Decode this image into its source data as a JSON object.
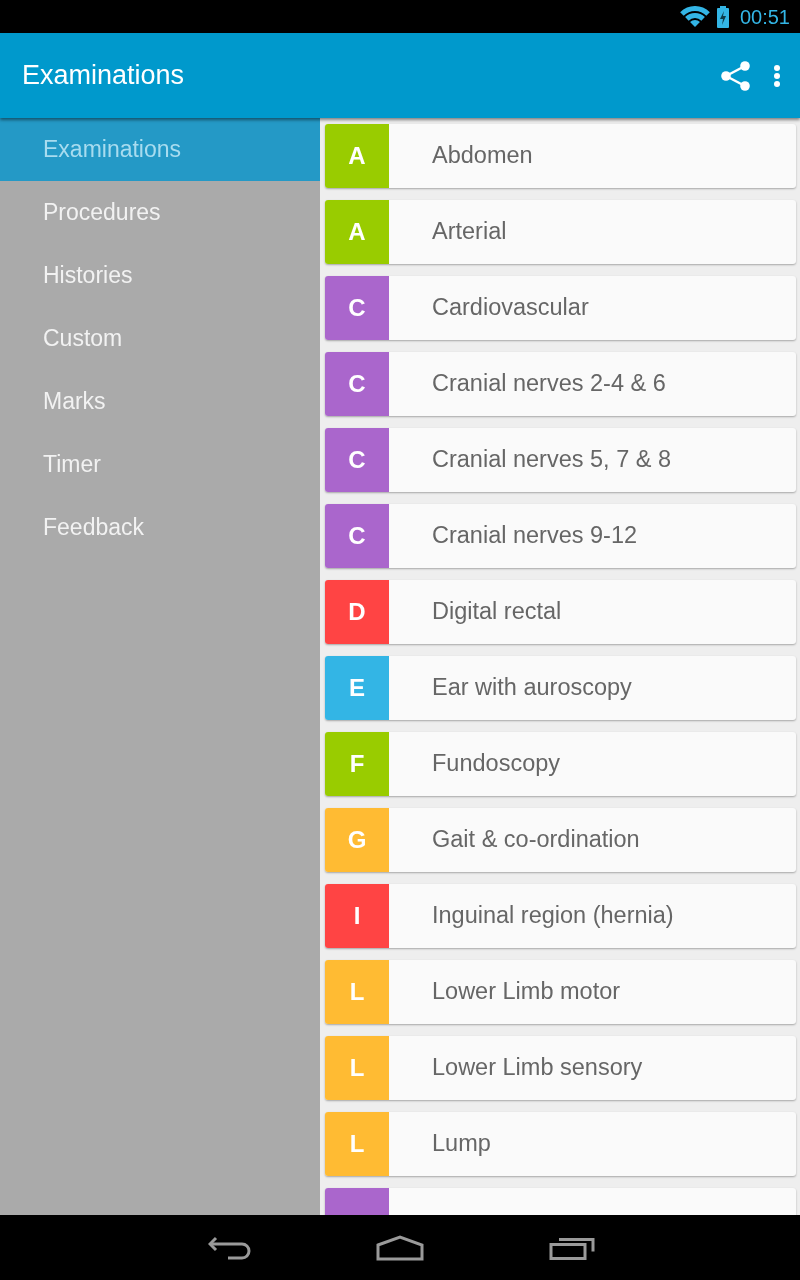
{
  "status_bar": {
    "time": "00:51"
  },
  "app_bar": {
    "title": "Examinations"
  },
  "sidebar": {
    "items": [
      {
        "label": "Examinations",
        "selected": true
      },
      {
        "label": "Procedures",
        "selected": false
      },
      {
        "label": "Histories",
        "selected": false
      },
      {
        "label": "Custom",
        "selected": false
      },
      {
        "label": "Marks",
        "selected": false
      },
      {
        "label": "Timer",
        "selected": false
      },
      {
        "label": "Feedback",
        "selected": false
      }
    ]
  },
  "list": {
    "items": [
      {
        "letter": "A",
        "label": "Abdomen",
        "color": "#99cc00"
      },
      {
        "letter": "A",
        "label": "Arterial",
        "color": "#99cc00"
      },
      {
        "letter": "C",
        "label": "Cardiovascular",
        "color": "#aa66cc"
      },
      {
        "letter": "C",
        "label": "Cranial nerves 2-4 & 6",
        "color": "#aa66cc"
      },
      {
        "letter": "C",
        "label": "Cranial nerves 5, 7 & 8",
        "color": "#aa66cc"
      },
      {
        "letter": "C",
        "label": "Cranial nerves 9-12",
        "color": "#aa66cc"
      },
      {
        "letter": "D",
        "label": "Digital rectal",
        "color": "#ff4444"
      },
      {
        "letter": "E",
        "label": "Ear with auroscopy",
        "color": "#33b5e5"
      },
      {
        "letter": "F",
        "label": "Fundoscopy",
        "color": "#99cc00"
      },
      {
        "letter": "G",
        "label": "Gait & co-ordination",
        "color": "#ffbb33"
      },
      {
        "letter": "I",
        "label": "Inguinal region (hernia)",
        "color": "#ff4444"
      },
      {
        "letter": "L",
        "label": "Lower Limb motor",
        "color": "#ffbb33"
      },
      {
        "letter": "L",
        "label": "Lower Limb sensory",
        "color": "#ffbb33"
      },
      {
        "letter": "L",
        "label": "Lump",
        "color": "#ffbb33"
      },
      {
        "color": "#aa66cc"
      }
    ]
  }
}
